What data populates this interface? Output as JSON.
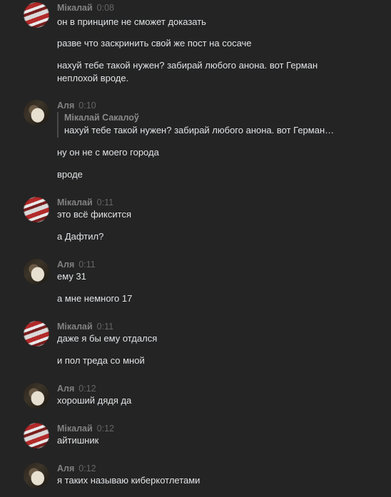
{
  "messages": [
    {
      "author": "Мікалай",
      "time": "0:08",
      "avatar": "flag-avatar",
      "lines": [
        "он в принципе не сможет доказать",
        "разве что заскринить свой же пост на сосаче",
        "нахуй тебе такой нужен? забирай любого анона. вот Герман",
        "неплохой вроде."
      ]
    },
    {
      "author": "Аля",
      "time": "0:10",
      "avatar": "cat-avatar",
      "reply": {
        "author": "Мікалай Сакалоў",
        "text": "нахуй тебе такой нужен? забирай любого анона. вот Герман…"
      },
      "lines": [
        "ну он не с моего города",
        "вроде"
      ]
    },
    {
      "author": "Мікалай",
      "time": "0:11",
      "avatar": "flag-avatar",
      "lines": [
        "это всё фиксится",
        "а Дафтил?"
      ]
    },
    {
      "author": "Аля",
      "time": "0:11",
      "avatar": "cat-avatar",
      "lines": [
        "ему 31",
        "а мне немного 17"
      ]
    },
    {
      "author": "Мікалай",
      "time": "0:11",
      "avatar": "flag-avatar",
      "lines": [
        "даже я бы ему отдался",
        "и пол треда со мной"
      ]
    },
    {
      "author": "Аля",
      "time": "0:12",
      "avatar": "cat-avatar",
      "lines": [
        "хороший дядя да"
      ]
    },
    {
      "author": "Мікалай",
      "time": "0:12",
      "avatar": "flag-avatar",
      "lines": [
        "айтишник"
      ]
    },
    {
      "author": "Аля",
      "time": "0:12",
      "avatar": "cat-avatar",
      "lines": [
        "я таких называю киберкотлетами"
      ]
    }
  ]
}
